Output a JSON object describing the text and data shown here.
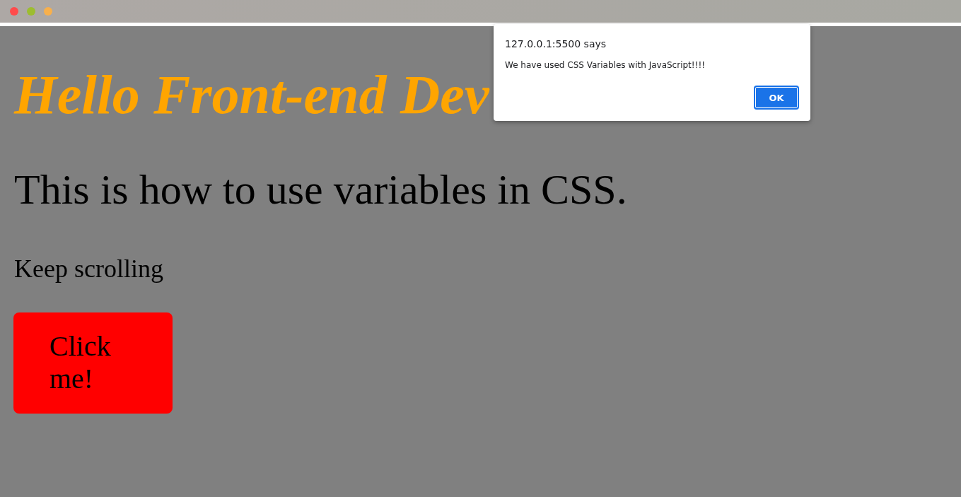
{
  "window": {
    "controls": [
      {
        "color": "#ff4b4b"
      },
      {
        "color": "#9dbd30"
      },
      {
        "color": "#f8b04c"
      }
    ]
  },
  "page": {
    "heading": "Hello Front-end Dev",
    "subheading": "This is how to use variables in CSS.",
    "paragraph": "Keep scrolling",
    "button": "Click me!"
  },
  "alert": {
    "title": "127.0.0.1:5500 says",
    "message": "We have used CSS Variables with JavaScript!!!!",
    "buttons": [
      "OK"
    ]
  }
}
